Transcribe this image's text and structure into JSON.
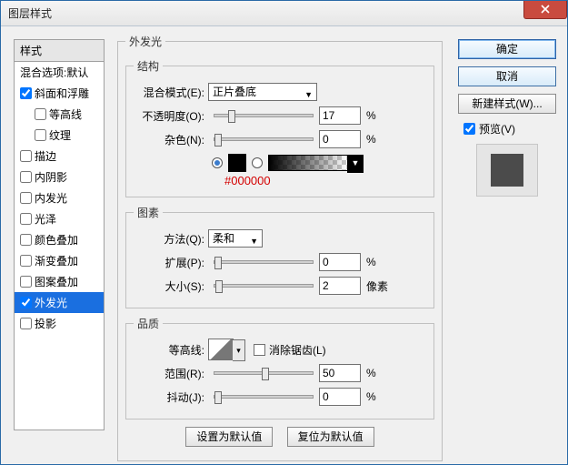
{
  "window": {
    "title": "图层样式"
  },
  "styles": {
    "header": "样式",
    "blend_defaults": "混合选项:默认",
    "items": [
      {
        "label": "斜面和浮雕",
        "checked": true,
        "indent": false
      },
      {
        "label": "等高线",
        "checked": false,
        "indent": true
      },
      {
        "label": "纹理",
        "checked": false,
        "indent": true
      },
      {
        "label": "描边",
        "checked": false,
        "indent": false
      },
      {
        "label": "内阴影",
        "checked": false,
        "indent": false
      },
      {
        "label": "内发光",
        "checked": false,
        "indent": false
      },
      {
        "label": "光泽",
        "checked": false,
        "indent": false
      },
      {
        "label": "颜色叠加",
        "checked": false,
        "indent": false
      },
      {
        "label": "渐变叠加",
        "checked": false,
        "indent": false
      },
      {
        "label": "图案叠加",
        "checked": false,
        "indent": false
      },
      {
        "label": "外发光",
        "checked": true,
        "indent": false,
        "selected": true
      },
      {
        "label": "投影",
        "checked": false,
        "indent": false
      }
    ]
  },
  "panel": {
    "title": "外发光",
    "groups": {
      "structure": {
        "legend": "结构",
        "blend_mode_label": "混合模式(E):",
        "blend_mode_value": "正片叠底",
        "opacity_label": "不透明度(O):",
        "opacity_value": "17",
        "opacity_unit": "%",
        "noise_label": "杂色(N):",
        "noise_value": "0",
        "noise_unit": "%",
        "color_hex": "#000000",
        "color_radio_solid": true,
        "color_radio_gradient": false
      },
      "elements": {
        "legend": "图素",
        "technique_label": "方法(Q):",
        "technique_value": "柔和",
        "spread_label": "扩展(P):",
        "spread_value": "0",
        "spread_unit": "%",
        "size_label": "大小(S):",
        "size_value": "2",
        "size_unit": "像素"
      },
      "quality": {
        "legend": "品质",
        "contour_label": "等高线:",
        "antialias_label": "消除锯齿(L)",
        "antialias_checked": false,
        "range_label": "范围(R):",
        "range_value": "50",
        "range_unit": "%",
        "jitter_label": "抖动(J):",
        "jitter_value": "0",
        "jitter_unit": "%"
      }
    },
    "footer": {
      "set_default": "设置为默认值",
      "reset_default": "复位为默认值"
    }
  },
  "right": {
    "ok": "确定",
    "cancel": "取消",
    "new_style": "新建样式(W)...",
    "preview_label": "预览(V)",
    "preview_checked": true
  },
  "slider_positions": {
    "opacity": 14,
    "noise": 0,
    "spread": 0,
    "size": 2,
    "range": 50,
    "jitter": 0
  },
  "colors": {
    "accent": "#1a6fe0",
    "hex_text": "#d40000"
  }
}
